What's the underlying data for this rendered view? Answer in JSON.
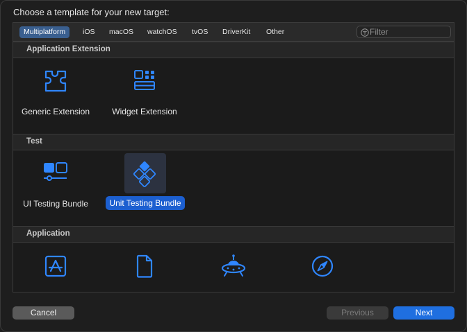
{
  "dialog": {
    "heading": "Choose a template for your new target:"
  },
  "platforms": [
    "Multiplatform",
    "iOS",
    "macOS",
    "watchOS",
    "tvOS",
    "DriverKit",
    "Other"
  ],
  "filter": {
    "placeholder": "Filter",
    "value": ""
  },
  "sections": {
    "application_extension": {
      "title": "Application Extension",
      "items": [
        {
          "label": "Generic Extension",
          "icon": "puzzle-piece-icon"
        },
        {
          "label": "Widget Extension",
          "icon": "widget-grid-icon"
        }
      ]
    },
    "test": {
      "title": "Test",
      "items": [
        {
          "label": "UI Testing Bundle",
          "icon": "ui-testing-icon"
        },
        {
          "label": "Unit Testing Bundle",
          "icon": "unit-testing-diamond-icon",
          "selected": true
        }
      ]
    },
    "application": {
      "title": "Application",
      "items": [
        {
          "label": "",
          "icon": "app-store-icon"
        },
        {
          "label": "",
          "icon": "document-icon"
        },
        {
          "label": "",
          "icon": "ufo-icon"
        },
        {
          "label": "",
          "icon": "safari-compass-icon"
        }
      ]
    }
  },
  "buttons": {
    "cancel": "Cancel",
    "previous": "Previous",
    "next": "Next"
  },
  "colors": {
    "accent": "#1f6fe0",
    "icon_blue": "#2f86ff",
    "selection": "#1c5fd0"
  }
}
